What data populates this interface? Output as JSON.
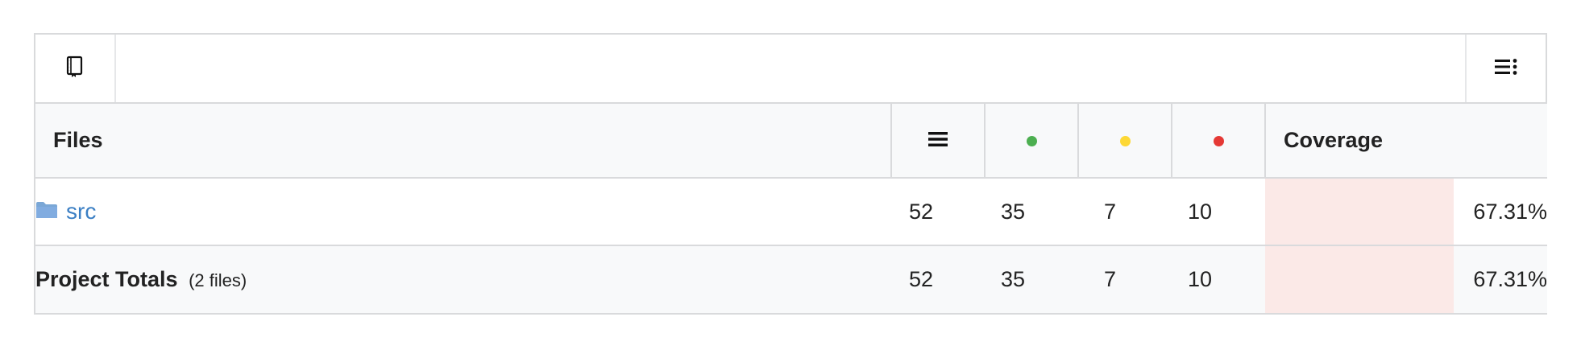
{
  "toolbar": {
    "left_icon": "book-icon",
    "right_icon": "list-menu-icon"
  },
  "table": {
    "headers": {
      "files": "Files",
      "lines_icon": "lines-icon",
      "covered_icon": "green-dot-icon",
      "partial_icon": "yellow-dot-icon",
      "missed_icon": "red-dot-icon",
      "coverage": "Coverage"
    },
    "rows": [
      {
        "name": "src",
        "icon": "folder-icon",
        "lines": "52",
        "covered": "35",
        "partial": "7",
        "missed": "10",
        "coverage": "67.31%",
        "coverage_value": 67.31
      }
    ],
    "totals": {
      "label": "Project Totals",
      "sublabel": "(2 files)",
      "lines": "52",
      "covered": "35",
      "partial": "7",
      "missed": "10",
      "coverage": "67.31%",
      "coverage_value": 67.31
    }
  },
  "colors": {
    "covered": "#4caf50",
    "partial": "#fdd835",
    "missed": "#e53935",
    "link": "#3b7fc4",
    "coverage_bar": "#fbe9e7",
    "header_bg": "#f8f9fa"
  }
}
